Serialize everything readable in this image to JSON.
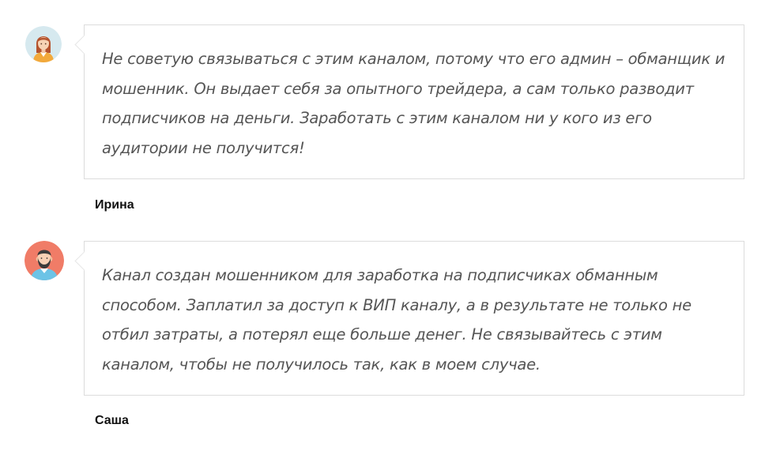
{
  "comments": [
    {
      "author": "Ирина",
      "avatar_icon": "woman-avatar-icon",
      "avatar_bg": "#d6e9ef",
      "text": "Не советую связываться с этим каналом, потому что его админ – обманщик и мошенник. Он выдает себя за опытного трейдера, а сам только разводит подписчиков на деньги. Заработать с этим каналом ни у кого из его аудитории не получится!"
    },
    {
      "author": "Саша",
      "avatar_icon": "bearded-man-avatar-icon",
      "avatar_bg": "#f07c67",
      "text": "Канал создан мошенником для заработка на подписчиках обманным способом. Заплатил за доступ к ВИП каналу, а в результате не только не отбил затраты, а потерял еще больше денег. Не связывайтесь с этим каналом, чтобы не получилось так, как в моем случае."
    }
  ]
}
